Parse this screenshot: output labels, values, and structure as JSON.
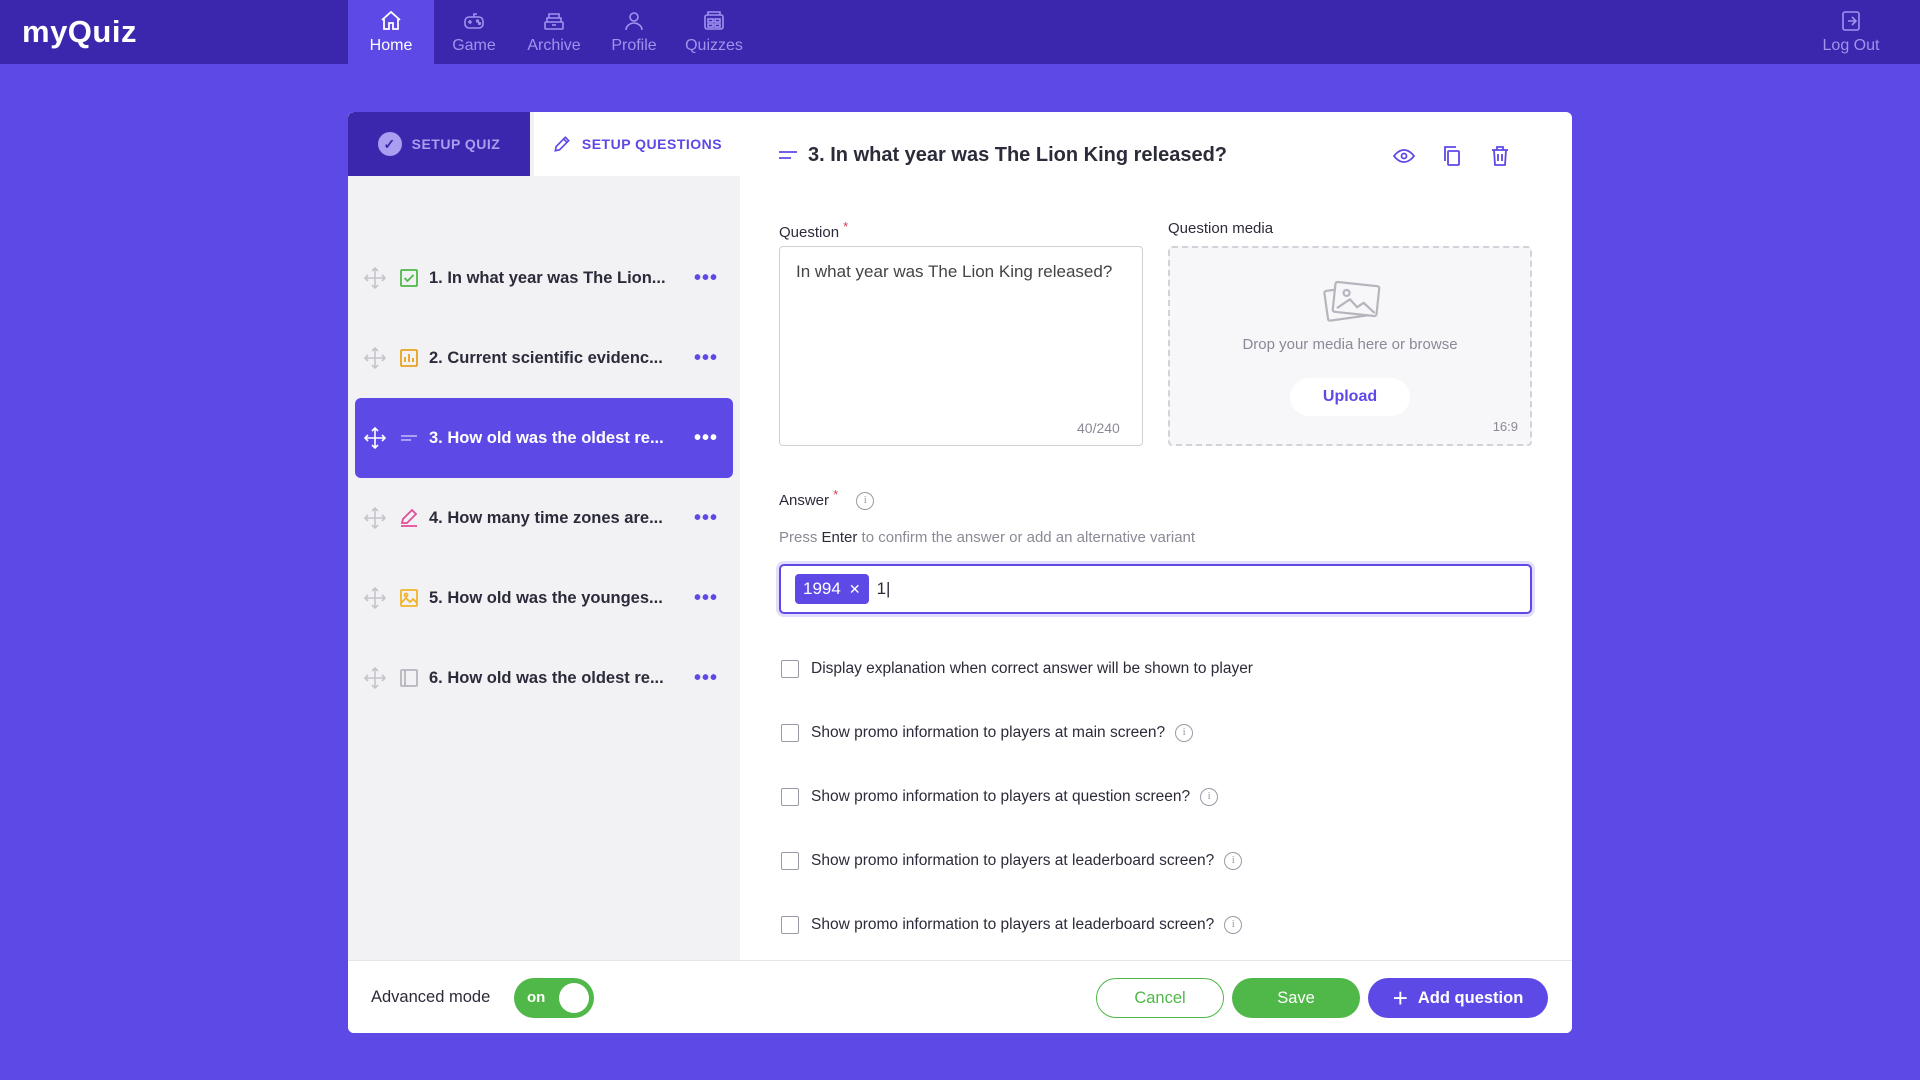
{
  "app": {
    "logo_text": "myQuiz"
  },
  "nav": {
    "items": [
      {
        "label": "Home",
        "icon": "home-icon",
        "active": true
      },
      {
        "label": "Game",
        "icon": "gamepad-icon"
      },
      {
        "label": "Archive",
        "icon": "archive-icon"
      },
      {
        "label": "Profile",
        "icon": "profile-icon"
      },
      {
        "label": "Quizzes",
        "icon": "quizzes-icon"
      }
    ],
    "logout_label": "Log Out"
  },
  "tabs": {
    "setup_quiz": "SETUP QUIZ",
    "setup_questions": "SETUP QUESTIONS"
  },
  "questions": [
    {
      "title": "1. In what year was The Lion...",
      "type_icon": "checkbox-icon"
    },
    {
      "title": "2. Current scientific evidenc...",
      "type_icon": "bar-chart-icon"
    },
    {
      "title": "3. How old was the oldest re...",
      "type_icon": "text-lines-icon",
      "active": true
    },
    {
      "title": "4. How many time zones are...",
      "type_icon": "pencil-icon"
    },
    {
      "title": "5. How old was the younges...",
      "type_icon": "image-icon"
    },
    {
      "title": "6. How old was the oldest re...",
      "type_icon": "slides-icon"
    }
  ],
  "editor": {
    "header_title": "3. In what year was The Lion King released?",
    "question_label": "Question",
    "question_required_mark": "*",
    "question_text": "In what year was The Lion King released?",
    "question_counter": "40/240",
    "media_label": "Question media",
    "media_drop_text": "Drop your media here or browse",
    "upload_label": "Upload",
    "media_ratio": "16:9",
    "answer_label": "Answer",
    "answer_required_mark": "*",
    "hint_prefix": "Press",
    "hint_key": "Enter",
    "hint_suffix": "to confirm the answer or add an alternative variant",
    "answer_chips": [
      "1994"
    ],
    "answer_input_value": "1|",
    "options": [
      {
        "label": "Display explanation when correct answer will be shown to player",
        "info": false
      },
      {
        "label": "Show promo information to players at main screen?",
        "info": true
      },
      {
        "label": "Show promo information to players at question screen?",
        "info": true
      },
      {
        "label": "Show promo information to players at leaderboard screen?",
        "info": true
      },
      {
        "label": "Show promo information to players at leaderboard screen?",
        "info": true
      }
    ]
  },
  "footer": {
    "advanced_mode_label": "Advanced mode",
    "toggle_label": "on",
    "cancel_label": "Cancel",
    "save_label": "Save",
    "add_question_label": "Add question"
  },
  "colors": {
    "brand": "#5d49e6",
    "nav_bg": "#3a27ad",
    "success": "#4fb848",
    "required": "#e0394f"
  }
}
